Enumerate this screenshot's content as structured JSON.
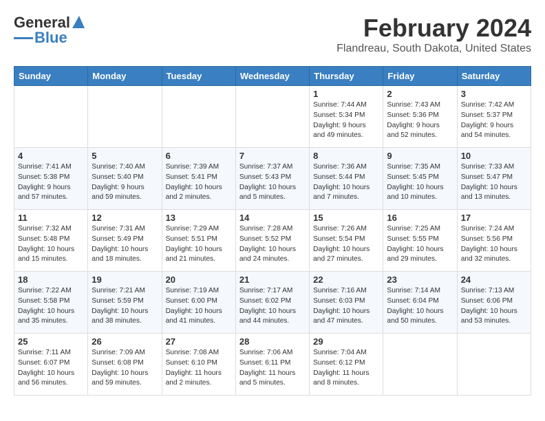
{
  "logo": {
    "text_general": "General",
    "text_blue": "Blue"
  },
  "title": {
    "month": "February 2024",
    "location": "Flandreau, South Dakota, United States"
  },
  "days_of_week": [
    "Sunday",
    "Monday",
    "Tuesday",
    "Wednesday",
    "Thursday",
    "Friday",
    "Saturday"
  ],
  "weeks": [
    [
      {
        "day": "",
        "info": ""
      },
      {
        "day": "",
        "info": ""
      },
      {
        "day": "",
        "info": ""
      },
      {
        "day": "",
        "info": ""
      },
      {
        "day": "1",
        "info": "Sunrise: 7:44 AM\nSunset: 5:34 PM\nDaylight: 9 hours\nand 49 minutes."
      },
      {
        "day": "2",
        "info": "Sunrise: 7:43 AM\nSunset: 5:36 PM\nDaylight: 9 hours\nand 52 minutes."
      },
      {
        "day": "3",
        "info": "Sunrise: 7:42 AM\nSunset: 5:37 PM\nDaylight: 9 hours\nand 54 minutes."
      }
    ],
    [
      {
        "day": "4",
        "info": "Sunrise: 7:41 AM\nSunset: 5:38 PM\nDaylight: 9 hours\nand 57 minutes."
      },
      {
        "day": "5",
        "info": "Sunrise: 7:40 AM\nSunset: 5:40 PM\nDaylight: 9 hours\nand 59 minutes."
      },
      {
        "day": "6",
        "info": "Sunrise: 7:39 AM\nSunset: 5:41 PM\nDaylight: 10 hours\nand 2 minutes."
      },
      {
        "day": "7",
        "info": "Sunrise: 7:37 AM\nSunset: 5:43 PM\nDaylight: 10 hours\nand 5 minutes."
      },
      {
        "day": "8",
        "info": "Sunrise: 7:36 AM\nSunset: 5:44 PM\nDaylight: 10 hours\nand 7 minutes."
      },
      {
        "day": "9",
        "info": "Sunrise: 7:35 AM\nSunset: 5:45 PM\nDaylight: 10 hours\nand 10 minutes."
      },
      {
        "day": "10",
        "info": "Sunrise: 7:33 AM\nSunset: 5:47 PM\nDaylight: 10 hours\nand 13 minutes."
      }
    ],
    [
      {
        "day": "11",
        "info": "Sunrise: 7:32 AM\nSunset: 5:48 PM\nDaylight: 10 hours\nand 15 minutes."
      },
      {
        "day": "12",
        "info": "Sunrise: 7:31 AM\nSunset: 5:49 PM\nDaylight: 10 hours\nand 18 minutes."
      },
      {
        "day": "13",
        "info": "Sunrise: 7:29 AM\nSunset: 5:51 PM\nDaylight: 10 hours\nand 21 minutes."
      },
      {
        "day": "14",
        "info": "Sunrise: 7:28 AM\nSunset: 5:52 PM\nDaylight: 10 hours\nand 24 minutes."
      },
      {
        "day": "15",
        "info": "Sunrise: 7:26 AM\nSunset: 5:54 PM\nDaylight: 10 hours\nand 27 minutes."
      },
      {
        "day": "16",
        "info": "Sunrise: 7:25 AM\nSunset: 5:55 PM\nDaylight: 10 hours\nand 29 minutes."
      },
      {
        "day": "17",
        "info": "Sunrise: 7:24 AM\nSunset: 5:56 PM\nDaylight: 10 hours\nand 32 minutes."
      }
    ],
    [
      {
        "day": "18",
        "info": "Sunrise: 7:22 AM\nSunset: 5:58 PM\nDaylight: 10 hours\nand 35 minutes."
      },
      {
        "day": "19",
        "info": "Sunrise: 7:21 AM\nSunset: 5:59 PM\nDaylight: 10 hours\nand 38 minutes."
      },
      {
        "day": "20",
        "info": "Sunrise: 7:19 AM\nSunset: 6:00 PM\nDaylight: 10 hours\nand 41 minutes."
      },
      {
        "day": "21",
        "info": "Sunrise: 7:17 AM\nSunset: 6:02 PM\nDaylight: 10 hours\nand 44 minutes."
      },
      {
        "day": "22",
        "info": "Sunrise: 7:16 AM\nSunset: 6:03 PM\nDaylight: 10 hours\nand 47 minutes."
      },
      {
        "day": "23",
        "info": "Sunrise: 7:14 AM\nSunset: 6:04 PM\nDaylight: 10 hours\nand 50 minutes."
      },
      {
        "day": "24",
        "info": "Sunrise: 7:13 AM\nSunset: 6:06 PM\nDaylight: 10 hours\nand 53 minutes."
      }
    ],
    [
      {
        "day": "25",
        "info": "Sunrise: 7:11 AM\nSunset: 6:07 PM\nDaylight: 10 hours\nand 56 minutes."
      },
      {
        "day": "26",
        "info": "Sunrise: 7:09 AM\nSunset: 6:08 PM\nDaylight: 10 hours\nand 59 minutes."
      },
      {
        "day": "27",
        "info": "Sunrise: 7:08 AM\nSunset: 6:10 PM\nDaylight: 11 hours\nand 2 minutes."
      },
      {
        "day": "28",
        "info": "Sunrise: 7:06 AM\nSunset: 6:11 PM\nDaylight: 11 hours\nand 5 minutes."
      },
      {
        "day": "29",
        "info": "Sunrise: 7:04 AM\nSunset: 6:12 PM\nDaylight: 11 hours\nand 8 minutes."
      },
      {
        "day": "",
        "info": ""
      },
      {
        "day": "",
        "info": ""
      }
    ]
  ]
}
